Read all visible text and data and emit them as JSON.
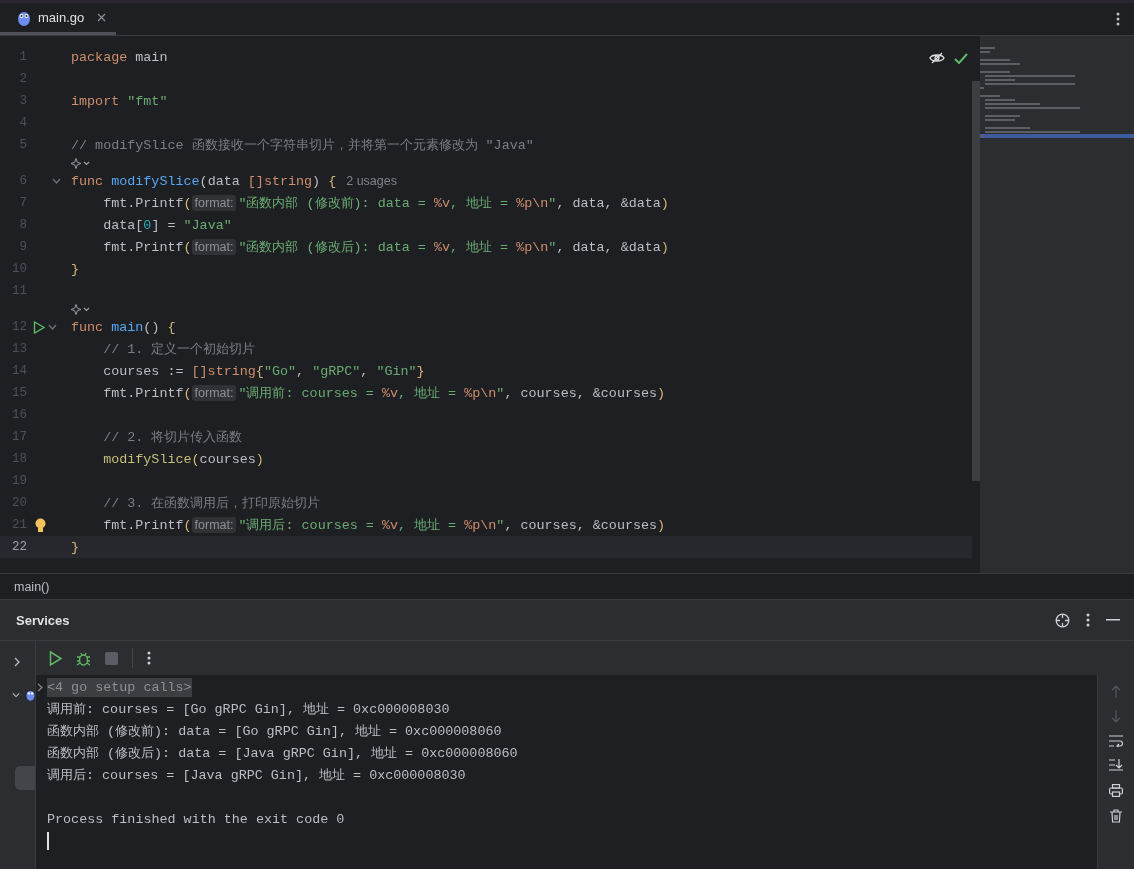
{
  "tabs": [
    {
      "label": "main.go",
      "selected": true
    }
  ],
  "editor": {
    "lines": [
      {
        "kind": "code",
        "number": "1",
        "current": false,
        "tokens": [
          {
            "kind": "kw",
            "text": "package "
          },
          {
            "kind": "plain",
            "text": "main"
          }
        ]
      },
      {
        "kind": "code",
        "number": "2",
        "current": false
      },
      {
        "kind": "code",
        "number": "3",
        "current": false,
        "tokens": [
          {
            "kind": "kw",
            "text": "import "
          },
          {
            "kind": "str",
            "text": "\"fmt\""
          }
        ]
      },
      {
        "kind": "code",
        "number": "4",
        "current": false
      },
      {
        "kind": "code",
        "number": "5",
        "current": false,
        "tokens": [
          {
            "kind": "cmt",
            "text": "// modifySlice 函数接收一个字符串切片，并将第一个元素修改为 \"Java\""
          }
        ]
      },
      {
        "kind": "inlay"
      },
      {
        "kind": "code",
        "number": "6",
        "current": false,
        "gutter": {
          "kind": "fold"
        },
        "tokens": [
          {
            "kind": "kw",
            "text": "func "
          },
          {
            "kind": "fn",
            "text": "modifySlice"
          },
          {
            "kind": "plain",
            "text": "(data "
          },
          {
            "kind": "kw",
            "text": "[]string"
          },
          {
            "kind": "plain",
            "text": ") "
          },
          {
            "kind": "paren",
            "text": "{"
          },
          {
            "kind": "usage",
            "text": "2 usages"
          }
        ]
      },
      {
        "kind": "code",
        "number": "7",
        "current": false,
        "tokens": [
          {
            "kind": "plain",
            "text": "    fmt.Printf"
          },
          {
            "kind": "paren",
            "text": "("
          },
          {
            "kind": "hint",
            "text": "format:"
          },
          {
            "kind": "str",
            "text": "\"函数内部 (修改前): data = "
          },
          {
            "kind": "esc",
            "text": "%v"
          },
          {
            "kind": "str",
            "text": ", 地址 = "
          },
          {
            "kind": "esc",
            "text": "%p\\n"
          },
          {
            "kind": "str",
            "text": "\""
          },
          {
            "kind": "plain",
            "text": ", data, &data"
          },
          {
            "kind": "paren",
            "text": ")"
          }
        ]
      },
      {
        "kind": "code",
        "number": "8",
        "current": false,
        "tokens": [
          {
            "kind": "plain",
            "text": "    data["
          },
          {
            "kind": "num",
            "text": "0"
          },
          {
            "kind": "plain",
            "text": "] = "
          },
          {
            "kind": "str",
            "text": "\"Java\""
          }
        ]
      },
      {
        "kind": "code",
        "number": "9",
        "current": false,
        "tokens": [
          {
            "kind": "plain",
            "text": "    fmt.Printf"
          },
          {
            "kind": "paren",
            "text": "("
          },
          {
            "kind": "hint",
            "text": "format:"
          },
          {
            "kind": "str",
            "text": "\"函数内部 (修改后): data = "
          },
          {
            "kind": "esc",
            "text": "%v"
          },
          {
            "kind": "str",
            "text": ", 地址 = "
          },
          {
            "kind": "esc",
            "text": "%p\\n"
          },
          {
            "kind": "str",
            "text": "\""
          },
          {
            "kind": "plain",
            "text": ", data, &data"
          },
          {
            "kind": "paren",
            "text": ")"
          }
        ]
      },
      {
        "kind": "code",
        "number": "10",
        "current": false,
        "tokens": [
          {
            "kind": "paren",
            "text": "}"
          }
        ]
      },
      {
        "kind": "code",
        "number": "11",
        "current": false
      },
      {
        "kind": "inlay"
      },
      {
        "kind": "code",
        "number": "12",
        "current": false,
        "gutter": {
          "kind": "run"
        },
        "tokens": [
          {
            "kind": "kw",
            "text": "func "
          },
          {
            "kind": "fn",
            "text": "main"
          },
          {
            "kind": "plain",
            "text": "() "
          },
          {
            "kind": "paren",
            "text": "{"
          }
        ]
      },
      {
        "kind": "code",
        "number": "13",
        "current": false,
        "tokens": [
          {
            "kind": "cmt",
            "text": "    // 1. 定义一个初始切片"
          }
        ]
      },
      {
        "kind": "code",
        "number": "14",
        "current": false,
        "tokens": [
          {
            "kind": "plain",
            "text": "    courses := "
          },
          {
            "kind": "kw",
            "text": "[]string"
          },
          {
            "kind": "paren",
            "text": "{"
          },
          {
            "kind": "str",
            "text": "\"Go\""
          },
          {
            "kind": "plain",
            "text": ", "
          },
          {
            "kind": "str",
            "text": "\"gRPC\""
          },
          {
            "kind": "plain",
            "text": ", "
          },
          {
            "kind": "str",
            "text": "\"Gin\""
          },
          {
            "kind": "paren",
            "text": "}"
          }
        ]
      },
      {
        "kind": "code",
        "number": "15",
        "current": false,
        "tokens": [
          {
            "kind": "plain",
            "text": "    fmt.Printf"
          },
          {
            "kind": "paren",
            "text": "("
          },
          {
            "kind": "hint",
            "text": "format:"
          },
          {
            "kind": "str",
            "text": "\"调用前: courses = "
          },
          {
            "kind": "esc",
            "text": "%v"
          },
          {
            "kind": "str",
            "text": ", 地址 = "
          },
          {
            "kind": "esc",
            "text": "%p\\n"
          },
          {
            "kind": "str",
            "text": "\""
          },
          {
            "kind": "plain",
            "text": ", courses, &courses"
          },
          {
            "kind": "paren",
            "text": ")"
          }
        ]
      },
      {
        "kind": "code",
        "number": "16",
        "current": false
      },
      {
        "kind": "code",
        "number": "17",
        "current": false,
        "tokens": [
          {
            "kind": "cmt",
            "text": "    // 2. 将切片传入函数"
          }
        ]
      },
      {
        "kind": "code",
        "number": "18",
        "current": false,
        "tokens": [
          {
            "kind": "call",
            "text": "    modifySlice"
          },
          {
            "kind": "paren",
            "text": "("
          },
          {
            "kind": "plain",
            "text": "courses"
          },
          {
            "kind": "paren",
            "text": ")"
          }
        ]
      },
      {
        "kind": "code",
        "number": "19",
        "current": false
      },
      {
        "kind": "code",
        "number": "20",
        "current": false,
        "tokens": [
          {
            "kind": "cmt",
            "text": "    // 3. 在函数调用后，打印原始切片"
          }
        ]
      },
      {
        "kind": "code",
        "number": "21",
        "current": false,
        "gutter": {
          "kind": "bulb"
        },
        "tokens": [
          {
            "kind": "plain",
            "text": "    fmt.Printf"
          },
          {
            "kind": "paren",
            "text": "("
          },
          {
            "kind": "hint",
            "text": "format:"
          },
          {
            "kind": "str",
            "text": "\"调用后: courses = "
          },
          {
            "kind": "esc",
            "text": "%v"
          },
          {
            "kind": "str",
            "text": ", 地址 = "
          },
          {
            "kind": "esc",
            "text": "%p\\n"
          },
          {
            "kind": "str",
            "text": "\""
          },
          {
            "kind": "plain",
            "text": ", courses, &courses"
          },
          {
            "kind": "paren",
            "text": ")"
          }
        ]
      },
      {
        "kind": "code",
        "number": "22",
        "current": true,
        "tokens": [
          {
            "kind": "paren",
            "text": "}"
          }
        ]
      }
    ]
  },
  "breadcrumb": "main()",
  "services": {
    "title": "Services",
    "tree": [
      {
        "expanded": false
      },
      {
        "expanded": true
      }
    ],
    "console": [
      {
        "kind": "folded",
        "text": "<4 go setup calls>"
      },
      {
        "kind": "output",
        "text": "调用前: courses = [Go gRPC Gin], 地址 = 0xc000008030"
      },
      {
        "kind": "output",
        "text": "函数内部 (修改前): data = [Go gRPC Gin], 地址 = 0xc000008060"
      },
      {
        "kind": "output",
        "text": "函数内部 (修改后): data = [Java gRPC Gin], 地址 = 0xc000008060"
      },
      {
        "kind": "output",
        "text": "调用后: courses = [Java gRPC Gin], 地址 = 0xc000008030"
      },
      {
        "kind": "blank"
      },
      {
        "kind": "output",
        "text": "Process finished with the exit code 0"
      }
    ]
  }
}
